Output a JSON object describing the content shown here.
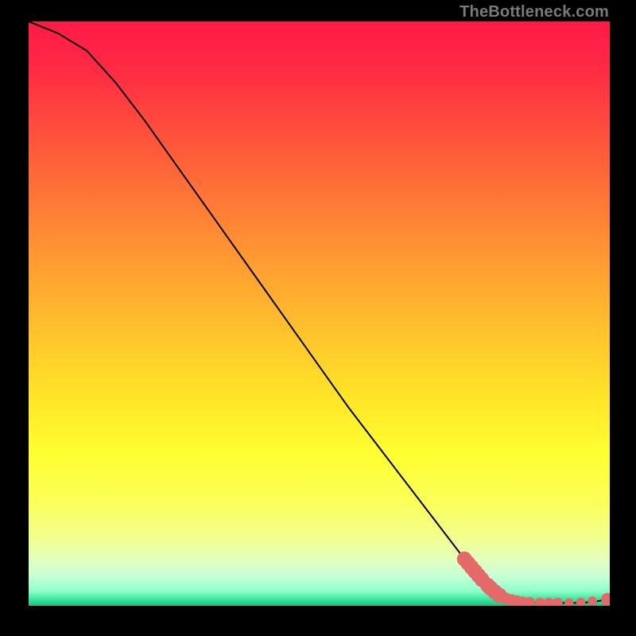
{
  "attribution": "TheBottleneck.com",
  "chart_data": {
    "type": "line",
    "title": "",
    "xlabel": "",
    "ylabel": "",
    "xlim": [
      0,
      100
    ],
    "ylim": [
      0,
      100
    ],
    "grid": false,
    "series": [
      {
        "name": "curve",
        "x": [
          0,
          5,
          10,
          15,
          20,
          25,
          30,
          35,
          40,
          45,
          50,
          55,
          60,
          65,
          70,
          75,
          78,
          80,
          82,
          85,
          88,
          90,
          92,
          94,
          96,
          98,
          100
        ],
        "y": [
          100,
          98,
          95,
          89.5,
          83,
          76,
          69,
          62,
          55,
          48,
          41,
          34,
          27.5,
          21,
          14.5,
          8,
          4.5,
          2.5,
          1.3,
          0.7,
          0.5,
          0.5,
          0.5,
          0.5,
          0.6,
          0.8,
          1.2
        ],
        "color": "#000000"
      }
    ],
    "highlight_points": [
      {
        "x": 75.0,
        "y": 8.0,
        "r": 1.3
      },
      {
        "x": 75.6,
        "y": 7.3,
        "r": 1.3
      },
      {
        "x": 76.2,
        "y": 6.6,
        "r": 1.3
      },
      {
        "x": 76.8,
        "y": 5.9,
        "r": 1.3
      },
      {
        "x": 77.4,
        "y": 5.2,
        "r": 1.3
      },
      {
        "x": 78.0,
        "y": 4.5,
        "r": 1.3
      },
      {
        "x": 79.0,
        "y": 3.5,
        "r": 1.3
      },
      {
        "x": 79.5,
        "y": 3.0,
        "r": 1.3
      },
      {
        "x": 80.2,
        "y": 2.4,
        "r": 1.3
      },
      {
        "x": 81.0,
        "y": 1.8,
        "r": 1.3
      },
      {
        "x": 82.0,
        "y": 1.3,
        "r": 1.0
      },
      {
        "x": 83.0,
        "y": 1.0,
        "r": 1.0
      },
      {
        "x": 84.0,
        "y": 0.8,
        "r": 1.0
      },
      {
        "x": 85.0,
        "y": 0.7,
        "r": 0.9
      },
      {
        "x": 86.2,
        "y": 0.6,
        "r": 0.9
      },
      {
        "x": 88.0,
        "y": 0.5,
        "r": 0.9
      },
      {
        "x": 89.5,
        "y": 0.5,
        "r": 0.9
      },
      {
        "x": 91.0,
        "y": 0.5,
        "r": 0.9
      },
      {
        "x": 93.0,
        "y": 0.5,
        "r": 0.8
      },
      {
        "x": 95.0,
        "y": 0.6,
        "r": 0.8
      },
      {
        "x": 97.0,
        "y": 0.8,
        "r": 0.8
      },
      {
        "x": 99.6,
        "y": 1.1,
        "r": 1.1
      }
    ],
    "highlight_color": "#e46a6a"
  }
}
